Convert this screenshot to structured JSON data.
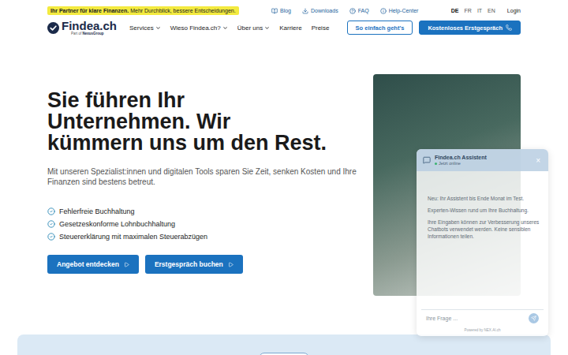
{
  "topbar": {
    "badge": {
      "bold": "Ihr Partner für klare Finanzen.",
      "text": "Mehr Durchblick, bessere Entscheidungen."
    },
    "links": [
      "Blog",
      "Downloads",
      "FAQ",
      "Help-Center"
    ],
    "languages": [
      {
        "label": "DE",
        "selected": true
      },
      {
        "label": "FR",
        "selected": false
      },
      {
        "label": "IT",
        "selected": false
      },
      {
        "label": "EN",
        "selected": false
      }
    ],
    "login": "Login"
  },
  "nav": {
    "logo": "Findea.ch",
    "logo_sub_prefix": "Part of",
    "logo_sub_brand": "NexusGroup",
    "items": [
      {
        "label": "Services",
        "dropdown": true
      },
      {
        "label": "Wieso Findea.ch?",
        "dropdown": true
      },
      {
        "label": "Über uns",
        "dropdown": true
      },
      {
        "label": "Karriere",
        "dropdown": false
      },
      {
        "label": "Preise",
        "dropdown": false
      }
    ],
    "buttons": [
      {
        "label": "So einfach geht's",
        "kind": "outline"
      },
      {
        "label": "Kostenloses Erstgespräch",
        "kind": "filled"
      }
    ]
  },
  "hero": {
    "heading": [
      "Sie führen Ihr",
      "Unternehmen. Wir",
      "kümmern uns um den Rest."
    ],
    "subtitle": "Mit unseren Spezialist:innen und digitalen Tools sparen Sie Zeit, senken Kosten und Ihre Finanzen sind bestens betreut.",
    "checklist": [
      "Fehlerfreie Buchhaltung",
      "Gesetzeskonforme Lohnbuchhaltung",
      "Steuererklärung mit maximalen Steuerabzügen"
    ],
    "buttons": [
      "Angebot entdecken",
      "Erstgespräch buchen"
    ]
  },
  "chat": {
    "title": "Findea.ch Assistent",
    "status": "Jetzt online",
    "close": "×",
    "messages": [
      "Neu: Ihr Assistent bis Ende Monat im Test.",
      "Experten-Wissen rund um Ihre Buchhaltung.",
      "Ihre Eingaben können zur Verbesserung unseres Chatbots verwendet werden. Keine sensiblen Informationen teilen."
    ],
    "input_placeholder": "Ihre Frage ...",
    "footer": "Powered by NEX.AI.ch"
  }
}
